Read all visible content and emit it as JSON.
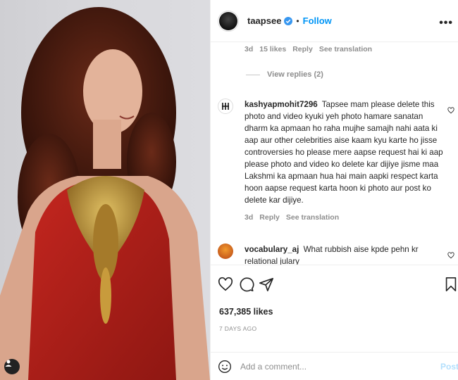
{
  "header": {
    "username": "taapsee",
    "separator": "•",
    "follow_label": "Follow",
    "more_label": "•••"
  },
  "top_comment_meta": {
    "age": "3d",
    "likes": "15 likes",
    "reply": "Reply",
    "translation": "See translation",
    "view_replies": "View replies (2)"
  },
  "comments": [
    {
      "username": "kashyapmohit7296",
      "text": "Tapsee mam please delete this photo and video kyuki yeh photo hamare sanatan dharm ka apmaan ho raha mujhe samajh nahi aata ki aap aur other celebrities aise kaam kyu karte ho jisse controversies ho please mere aapse request hai ki aap please photo and video ko delete kar dijiye jisme maa Lakshmi ka apmaan hua hai main aapki respect karta hoon aapse request karta hoon ki photo aur post ko delete kar dijiye.",
      "age": "3d",
      "reply": "Reply",
      "translation": "See translation"
    },
    {
      "username": "vocabulary_aj",
      "text": "What rubbish aise kpde pehn kr relational julary"
    }
  ],
  "post": {
    "likes": "637,385 likes",
    "time": "7 DAYS AGO"
  },
  "add_comment": {
    "placeholder": "Add a comment...",
    "post_label": "Post"
  },
  "colors": {
    "accent": "#0095f6",
    "post_disabled": "#b2dffc",
    "muted": "#8e8e8e",
    "dress_red": "#b0201c",
    "gold": "#b8902e"
  }
}
